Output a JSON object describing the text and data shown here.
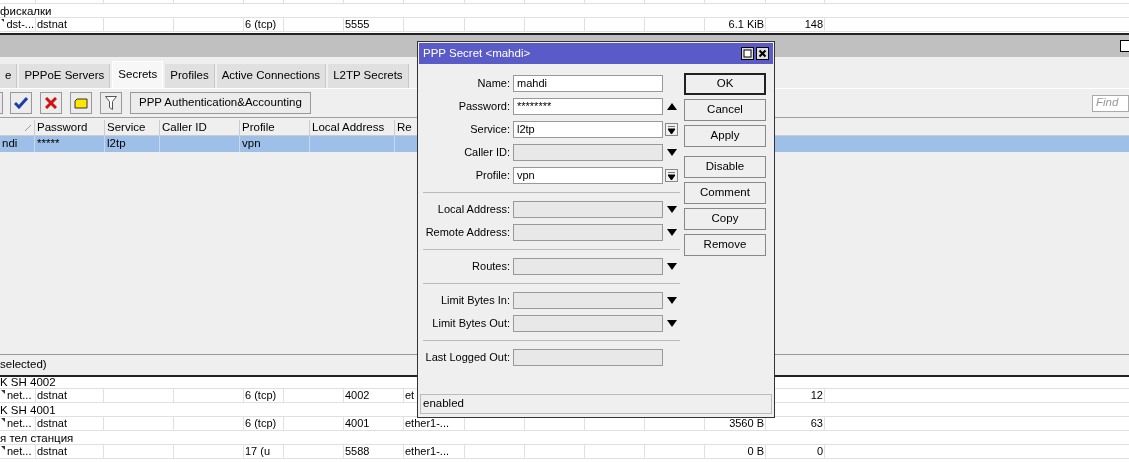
{
  "nat_top": {
    "rows": [
      {
        "kind": "stub"
      },
      {
        "kind": "comment",
        "text": "фискалки"
      },
      {
        "kind": "rule",
        "cells": {
          "column_1": "dst-...",
          "column_2": "dstnat",
          "column_5": "6 (tcp)",
          "column_7": "5555",
          "column_13": "6.1 KiB",
          "column_14": "148"
        }
      }
    ]
  },
  "ppp_window": {
    "tabs": [
      {
        "label": "e",
        "selected": false
      },
      {
        "label": "PPPoE Servers",
        "selected": false
      },
      {
        "label": "Secrets",
        "selected": true
      },
      {
        "label": "Profiles",
        "selected": false
      },
      {
        "label": "Active Connections",
        "selected": false
      },
      {
        "label": "L2TP Secrets",
        "selected": false
      }
    ],
    "toolbar": {
      "tools": [
        {
          "kind": "enable"
        },
        {
          "kind": "disable"
        },
        {
          "kind": "comment"
        },
        {
          "kind": "filter"
        }
      ],
      "auth_button": "PPP Authentication&Accounting",
      "search": {
        "placeholder": "Find"
      }
    },
    "table": {
      "columns": [
        "",
        "Password",
        "Service",
        "Caller ID",
        "Profile",
        "Local Address",
        "Re"
      ],
      "rows": [
        {
          "selected": true,
          "cells": [
            "ndi",
            "*****",
            "l2tp",
            "",
            "vpn",
            "",
            ""
          ]
        }
      ]
    },
    "status_bar": "selected)"
  },
  "nat_bottom": {
    "rows": [
      {
        "kind": "comment",
        "text": "K SH 4002"
      },
      {
        "kind": "rule",
        "cells": {
          "column_1": "net...",
          "column_2": "dstnat",
          "column_5": "6 (tcp)",
          "column_7": "4002",
          "column_8": "et",
          "column_14": "12"
        }
      },
      {
        "kind": "comment",
        "text": "K SH 4001"
      },
      {
        "kind": "rule",
        "cells": {
          "column_1": "net...",
          "column_2": "dstnat",
          "column_5": "6 (tcp)",
          "column_7": "4001",
          "column_8": "ether1-...",
          "column_13": "3560 B",
          "column_14": "63"
        }
      },
      {
        "kind": "comment",
        "text": "я тел станция"
      },
      {
        "kind": "rule",
        "cells": {
          "column_1": "net...",
          "column_2": "dstnat",
          "column_5": "17 (u",
          "column_7": "5588",
          "column_8": "ether1-...",
          "column_13": "0 B",
          "column_14": "0"
        }
      }
    ]
  },
  "dialog": {
    "title": "PPP Secret <mahdi>",
    "field_groups": [
      [
        {
          "label": "Name:",
          "value": "mahdi",
          "kind": "plain"
        },
        {
          "label": "Password:",
          "value": "********",
          "kind": "up"
        },
        {
          "label": "Service:",
          "value": "l2tp",
          "kind": "combo"
        },
        {
          "label": "Caller ID:",
          "kind": "down"
        },
        {
          "label": "Profile:",
          "value": "vpn",
          "kind": "combo"
        }
      ],
      [
        {
          "label": "Local Address:",
          "kind": "down"
        },
        {
          "label": "Remote Address:",
          "kind": "down"
        }
      ],
      [
        {
          "label": "Routes:",
          "kind": "down"
        }
      ],
      [
        {
          "label": "Limit Bytes In:",
          "kind": "down"
        },
        {
          "label": "Limit Bytes Out:",
          "kind": "down"
        }
      ],
      [
        {
          "label": "Last Logged Out:",
          "kind": "plain"
        }
      ]
    ],
    "buttons": [
      {
        "label": "OK",
        "default": true
      },
      {
        "label": "Cancel",
        "default": false
      },
      {
        "label": "Apply",
        "default": false
      }
    ],
    "action_buttons": [
      {
        "label": "Disable",
        "default": false
      },
      {
        "label": "Comment",
        "default": false
      },
      {
        "label": "Copy",
        "default": false
      },
      {
        "label": "Remove",
        "default": false
      }
    ],
    "status": "enabled"
  }
}
